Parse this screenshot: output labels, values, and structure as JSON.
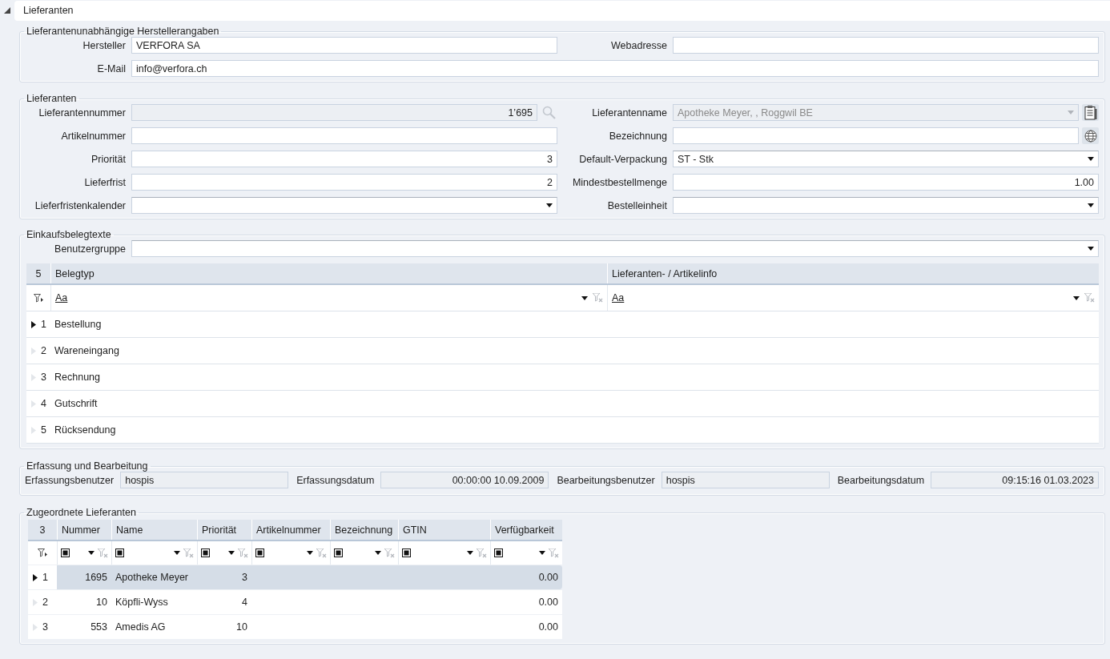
{
  "header": {
    "title": "Lieferanten",
    "expanded": true
  },
  "manufacturer": {
    "title": "Lieferantenunabhängige Herstellerangaben",
    "rows": [
      [
        {
          "label": "Hersteller",
          "kind": "text",
          "value": "VERFORA SA"
        },
        {
          "label": "Webadresse",
          "kind": "text"
        }
      ],
      [
        {
          "label": "E-Mail",
          "kind": "text",
          "value": "info@verfora.ch"
        }
      ]
    ]
  },
  "suppliers": {
    "title": "Lieferanten",
    "rows": [
      [
        {
          "label": "Lieferantennummer",
          "kind": "lookup",
          "value": "1’695"
        },
        {
          "label": "Lieferantenname",
          "kind": "lookup_select",
          "value": "Apotheke Meyer, , Roggwil BE"
        }
      ],
      [
        {
          "label": "Artikelnummer",
          "kind": "text"
        },
        {
          "label": "Bezeichnung",
          "kind": "translatable"
        }
      ],
      [
        {
          "label": "Priorität",
          "kind": "number",
          "value": "3"
        },
        {
          "label": "Default-Verpackung",
          "kind": "select",
          "value": "ST - Stk"
        }
      ],
      [
        {
          "label": "Lieferfrist",
          "kind": "number",
          "value": "2"
        },
        {
          "label": "Mindestbestellmenge",
          "kind": "number",
          "value": "1.00"
        }
      ],
      [
        {
          "label": "Lieferfristenkalender",
          "kind": "select"
        },
        {
          "label": "Bestelleinheit",
          "kind": "select"
        }
      ]
    ]
  },
  "purchase_texts": {
    "title": "Einkaufsbelegtexte",
    "rows": [
      [
        {
          "label": "Benutzergruppe",
          "kind": "select"
        }
      ]
    ],
    "grid": {
      "count": "5",
      "columns": [
        {
          "label": "Belegtyp",
          "filter_operator": "Aa"
        },
        {
          "label": "Lieferanten- / Artikelinfo",
          "filter_operator": "Aa"
        }
      ],
      "rows": [
        {
          "number": "1",
          "selected": true,
          "cells": [
            "Bestellung"
          ]
        },
        {
          "number": "2",
          "selected": false,
          "cells": [
            "Wareneingang"
          ]
        },
        {
          "number": "3",
          "selected": false,
          "cells": [
            "Rechnung"
          ]
        },
        {
          "number": "4",
          "selected": false,
          "cells": [
            "Gutschrift"
          ]
        },
        {
          "number": "5",
          "selected": false,
          "cells": [
            "Rücksendung"
          ]
        }
      ]
    }
  },
  "audit": {
    "title": "Erfassung und Bearbeitung",
    "fields": [
      {
        "label": "Erfassungsbenutzer",
        "kind": "text",
        "value": "hospis"
      },
      {
        "label": "Erfassungsdatum",
        "kind": "datetime",
        "value": "00:00:00 10.09.2009"
      },
      {
        "label": "Bearbeitungsbenutzer",
        "kind": "text",
        "value": "hospis"
      },
      {
        "label": "Bearbeitungsdatum",
        "kind": "datetime",
        "value": "09:15:16 01.03.2023"
      }
    ]
  },
  "assigned": {
    "title": "Zugeordnete Lieferanten",
    "count": "3",
    "columns": [
      {
        "label": "Nummer",
        "kind": "number"
      },
      {
        "label": "Name",
        "kind": "text"
      },
      {
        "label": "Priorität",
        "kind": "number"
      },
      {
        "label": "Artikelnummer"
      },
      {
        "label": "Bezeichnung"
      },
      {
        "label": "GTIN"
      },
      {
        "label": "Verfügbarkeit",
        "kind": "number"
      }
    ],
    "rows": [
      {
        "number": "1",
        "selected": true,
        "cells": [
          "1695",
          "Apotheke Meyer",
          "3",
          "",
          "",
          "",
          "0.00"
        ]
      },
      {
        "number": "2",
        "selected": false,
        "cells": [
          "10",
          "Köpfli-Wyss",
          "4",
          "",
          "",
          "",
          "0.00"
        ]
      },
      {
        "number": "3",
        "selected": false,
        "cells": [
          "553",
          "Amedis AG",
          "10",
          "",
          "",
          "",
          "0.00"
        ]
      }
    ]
  }
}
